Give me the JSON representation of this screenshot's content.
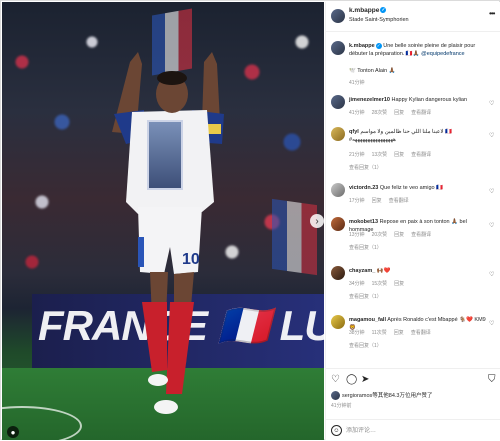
{
  "post": {
    "username": "k.mbappe",
    "location": "Stade Saint-Symphorien",
    "more_icon": "more-icon",
    "caption": {
      "username": "k.mbappe",
      "text": "Une belle soirée pleine de plaisir pour débuter la préparation. 🇫🇷🙏🏾",
      "tag": "@equipedefrance",
      "extra": "🕊️ Tonton Alain 🙏🏾",
      "time": "41分钟"
    },
    "photo": {
      "board_text": "FRANCE 🇫🇷 LUXEMBOURG",
      "jersey_number": "10",
      "expand_icon": "chevron-right-icon",
      "user_tag_icon": "person-icon"
    }
  },
  "comments": [
    {
      "username": "jimenezelmer10",
      "text": "Happy Kylian dangerous kylian",
      "time": "41分钟",
      "likes": "28次赞",
      "reply": "回复",
      "translate": "查看翻译",
      "replies": ""
    },
    {
      "username": "qfyl",
      "text": "لاعبنا ملنا اللي حنا ظالمين ولا مواسم 🇫🇷 #ههههههههههههههههه",
      "time": "21分钟",
      "likes": "13次赞",
      "reply": "回复",
      "translate": "查看翻译",
      "replies": "查看回复（1）"
    },
    {
      "username": "victordn.23",
      "text": "Que feliz te veo amigo 🇫🇷",
      "time": "17分钟",
      "likes": "",
      "reply": "回复",
      "translate": "查看翻译",
      "replies": ""
    },
    {
      "username": "mokobet13",
      "text": "Repose en paix à son tonton 🙏🏾 bel hommage",
      "time": "13分钟",
      "likes": "20次赞",
      "reply": "回复",
      "translate": "查看翻译",
      "replies": "查看回复（1）"
    },
    {
      "username": "chayzam_",
      "text": "🙌🏾❤️",
      "time": "34分钟",
      "likes": "15次赞",
      "reply": "回复",
      "translate": "",
      "replies": "查看回复（1）"
    },
    {
      "username": "magamou_fall",
      "text": "Après Ronaldo c'est Mbappé 🐐❤️ KM9 🦁",
      "time": "38分钟",
      "likes": "11次赞",
      "reply": "回复",
      "translate": "查看翻译",
      "replies": "查看回复（1）"
    }
  ],
  "actions": {
    "like_icon": "heart-icon",
    "comment_icon": "comment-icon",
    "share_icon": "share-icon",
    "save_icon": "bookmark-icon",
    "likes_text": "sergioramos等其他84.3万位用户赞了",
    "likes_user": "sergioramos",
    "post_time": "41分钟前",
    "comment_placeholder": "添加评论…",
    "emoji_icon": "emoji-icon"
  }
}
